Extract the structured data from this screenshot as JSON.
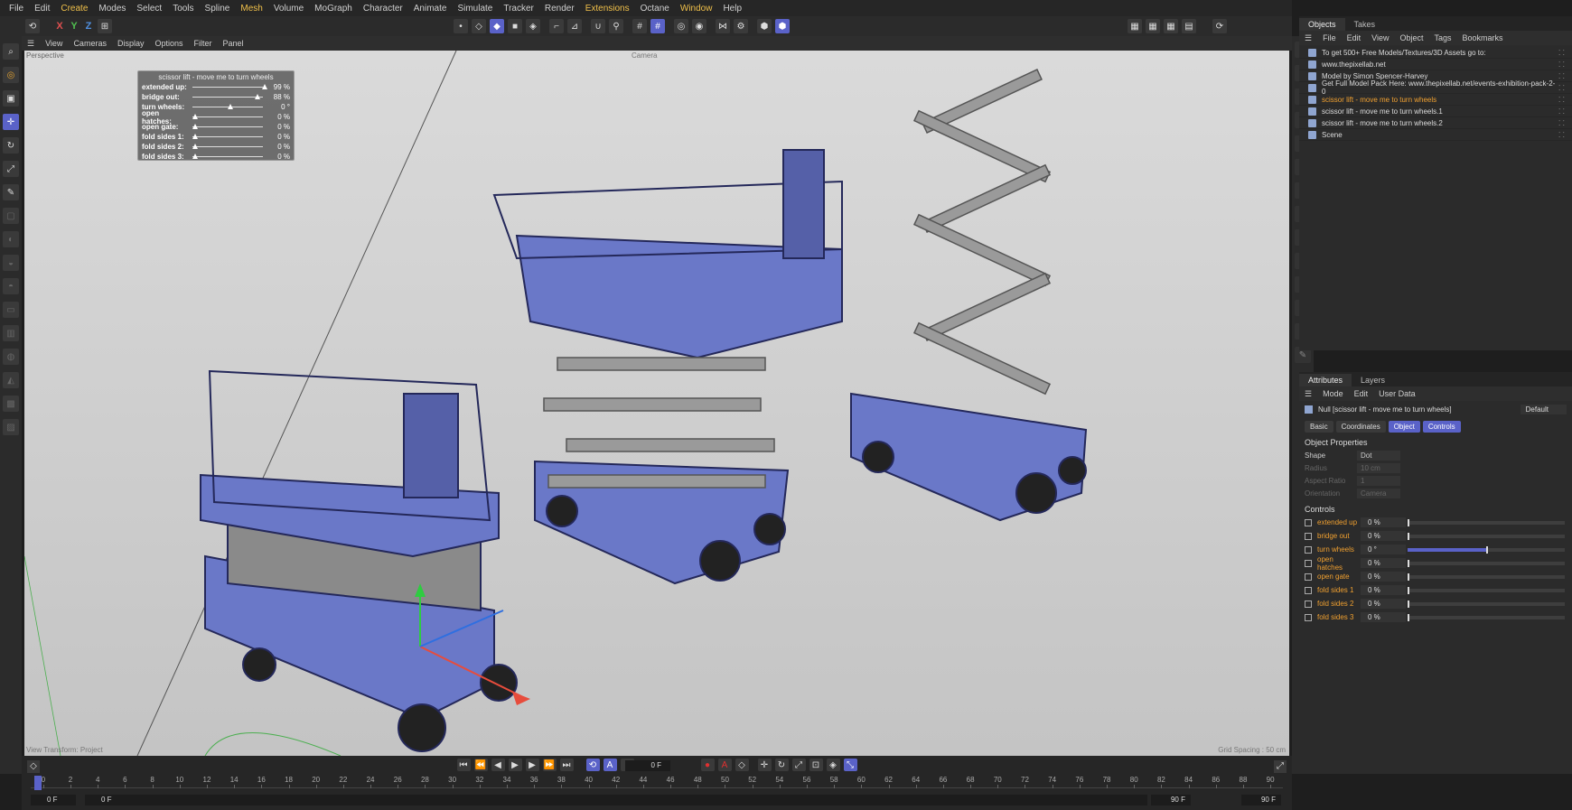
{
  "menu": [
    "File",
    "Edit",
    "Create",
    "Modes",
    "Select",
    "Tools",
    "Spline",
    "Mesh",
    "Volume",
    "MoGraph",
    "Character",
    "Animate",
    "Simulate",
    "Tracker",
    "Render",
    "Extensions",
    "Octane",
    "Window",
    "Help"
  ],
  "menu_highlight": [
    "Create",
    "Mesh",
    "Extensions",
    "Window"
  ],
  "axis_toggles": [
    "X",
    "Y",
    "Z"
  ],
  "viewport": {
    "menu": [
      "View",
      "Cameras",
      "Display",
      "Options",
      "Filter",
      "Panel"
    ],
    "label": "Perspective",
    "camera_label": "Camera",
    "footer_left": "View Transform: Project",
    "footer_right": "Grid Spacing : 50 cm"
  },
  "hud": {
    "title": "scissor lift - move me to turn wheels",
    "rows": [
      {
        "label": "extended up:",
        "value": "99 %",
        "level": 0.99
      },
      {
        "label": "bridge out:",
        "value": "88 %",
        "level": 0.88
      },
      {
        "label": "turn wheels:",
        "value": "0 °",
        "level": 0.5
      },
      {
        "label": "open hatches:",
        "value": "0 %",
        "level": 0
      },
      {
        "label": "open gate:",
        "value": "0 %",
        "level": 0
      },
      {
        "label": "fold sides 1:",
        "value": "0 %",
        "level": 0
      },
      {
        "label": "fold sides 2:",
        "value": "0 %",
        "level": 0
      },
      {
        "label": "fold sides 3:",
        "value": "0 %",
        "level": 0
      }
    ]
  },
  "objects_panel": {
    "tabs": [
      "Objects",
      "Takes"
    ],
    "menu": [
      "File",
      "Edit",
      "View",
      "Object",
      "Tags",
      "Bookmarks"
    ],
    "items": [
      {
        "label": "To get 500+ Free Models/Textures/3D Assets go to:",
        "selected": false
      },
      {
        "label": "www.thepixellab.net",
        "selected": false
      },
      {
        "label": "Model by Simon Spencer-Harvey",
        "selected": false
      },
      {
        "label": "Get Full Model Pack Here: www.thepixellab.net/events-exhibition-pack-2-0",
        "selected": false
      },
      {
        "label": "scissor lift - move me to turn wheels",
        "selected": true
      },
      {
        "label": "scissor lift - move me to turn wheels.1",
        "selected": false
      },
      {
        "label": "scissor lift - move me to turn wheels.2",
        "selected": false
      },
      {
        "label": "Scene",
        "selected": false
      }
    ]
  },
  "attributes_panel": {
    "tabs": [
      "Attributes",
      "Layers"
    ],
    "menu": [
      "Mode",
      "Edit",
      "User Data"
    ],
    "object_title": "Null [scissor lift - move me to turn wheels]",
    "preset": "Default",
    "buttons": [
      {
        "label": "Basic",
        "active": false
      },
      {
        "label": "Coordinates",
        "active": false
      },
      {
        "label": "Object",
        "active": true
      },
      {
        "label": "Controls",
        "active": true
      }
    ],
    "object_properties_title": "Object Properties",
    "props": [
      {
        "label": "Shape",
        "value": "Dot",
        "dim": false
      },
      {
        "label": "Radius",
        "value": "10 cm",
        "dim": true
      },
      {
        "label": "Aspect Ratio",
        "value": "1",
        "dim": true
      },
      {
        "label": "Orientation",
        "value": "Camera",
        "dim": true
      }
    ],
    "controls_title": "Controls",
    "controls": [
      {
        "label": "extended up",
        "value": "0 %",
        "level": 0
      },
      {
        "label": "bridge out",
        "value": "0 %",
        "level": 0
      },
      {
        "label": "turn wheels",
        "value": "0 °",
        "level": 0.5
      },
      {
        "label": "open hatches",
        "value": "0 %",
        "level": 0
      },
      {
        "label": "open gate",
        "value": "0 %",
        "level": 0
      },
      {
        "label": "fold sides 1",
        "value": "0 %",
        "level": 0
      },
      {
        "label": "fold sides 2",
        "value": "0 %",
        "level": 0
      },
      {
        "label": "fold sides 3",
        "value": "0 %",
        "level": 0
      }
    ]
  },
  "timeline": {
    "current_frame": "0 F",
    "start": "0 F",
    "min": "0 F",
    "max": "90 F",
    "end": "90 F",
    "ticks": [
      0,
      2,
      4,
      6,
      8,
      10,
      12,
      14,
      16,
      18,
      20,
      22,
      24,
      26,
      28,
      30,
      32,
      34,
      36,
      38,
      40,
      42,
      44,
      46,
      48,
      50,
      52,
      54,
      56,
      58,
      60,
      62,
      64,
      66,
      68,
      70,
      72,
      74,
      76,
      78,
      80,
      82,
      84,
      86,
      88,
      90
    ]
  },
  "colors": {
    "accent": "#5a62c8",
    "selected": "#f0a030",
    "model": "#6a78c8"
  }
}
